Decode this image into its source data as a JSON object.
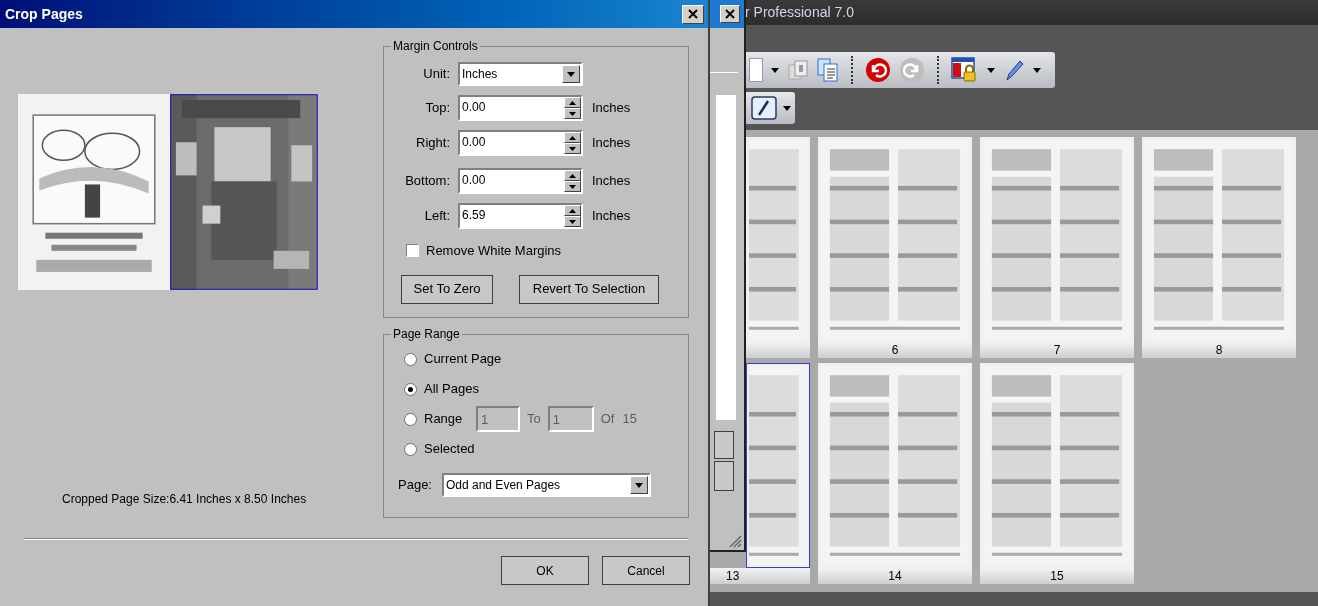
{
  "app_window": {
    "title": "r Professional 7.0",
    "page_rows": [
      [
        {
          "selected": false
        },
        {
          "label": "6",
          "selected": false
        },
        {
          "label": "7",
          "selected": false
        },
        {
          "label": "8",
          "selected": false
        }
      ],
      [
        {
          "label": "13",
          "selected": true
        },
        {
          "label": "14",
          "selected": false
        },
        {
          "label": "15",
          "selected": false
        }
      ]
    ]
  },
  "dialog": {
    "title": "Crop Pages",
    "preview": {
      "caption": "Cropped Page Size:6.41 Inches x 8.50 Inches"
    },
    "margin_controls": {
      "legend": "Margin Controls",
      "unit": {
        "label": "Unit:",
        "value": "Inches"
      },
      "margins": [
        {
          "label": "Top:",
          "value": "0.00",
          "unit": "Inches"
        },
        {
          "label": "Right:",
          "value": "0.00",
          "unit": "Inches"
        },
        {
          "label": "Bottom:",
          "value": "0.00",
          "unit": "Inches"
        },
        {
          "label": "Left:",
          "value": "6.59",
          "unit": "Inches"
        }
      ],
      "remove_white_margins": {
        "label": "Remove White Margins",
        "checked": false
      },
      "buttons": [
        "Set To Zero",
        "Revert To Selection"
      ]
    },
    "page_range": {
      "legend": "Page Range",
      "options": [
        {
          "label": "Current Page",
          "selected": false,
          "kind": "plain"
        },
        {
          "label": "All Pages",
          "selected": true,
          "kind": "plain"
        },
        {
          "label": "Range",
          "selected": false,
          "kind": "range"
        },
        {
          "label": "Selected",
          "selected": false,
          "kind": "plain"
        }
      ],
      "range": {
        "from": "1",
        "to_label": "To",
        "to": "1",
        "of_label": "Of",
        "total": "15",
        "disabled": true
      },
      "page": {
        "label": "Page:",
        "value": "Odd and Even Pages"
      }
    },
    "buttons": [
      "OK",
      "Cancel"
    ]
  }
}
